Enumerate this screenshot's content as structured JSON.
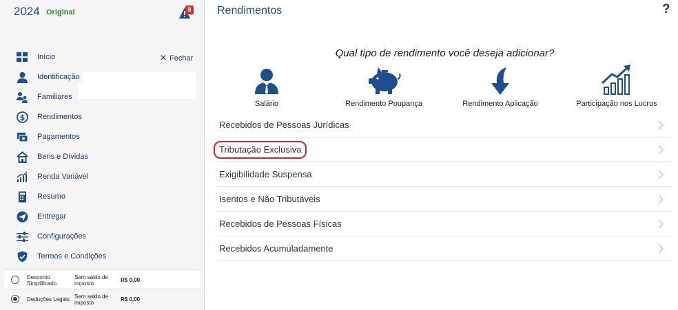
{
  "header": {
    "year": "2024",
    "version": "Original",
    "alert_count": "8"
  },
  "sidebar": {
    "close_label": "Fechar",
    "items": [
      {
        "label": "Início",
        "icon": "grid-icon"
      },
      {
        "label": "Identificação",
        "icon": "person-icon"
      },
      {
        "label": "Familiares",
        "icon": "family-icon"
      },
      {
        "label": "Rendimentos",
        "icon": "dollar-icon"
      },
      {
        "label": "Pagamentos",
        "icon": "payment-icon"
      },
      {
        "label": "Bens e Dívidas",
        "icon": "house-icon"
      },
      {
        "label": "Renda Variável",
        "icon": "chart-icon"
      },
      {
        "label": "Resumo",
        "icon": "calculator-icon"
      },
      {
        "label": "Entregar",
        "icon": "send-icon"
      },
      {
        "label": "Configurações",
        "icon": "sliders-icon"
      },
      {
        "label": "Termos e Condições",
        "icon": "shield-icon"
      }
    ],
    "summary": [
      {
        "name": "Desconto Simplificado",
        "status": "Sem saldo de imposto",
        "value": "R$ 0,00",
        "selected": false
      },
      {
        "name": "Deduções Legais",
        "status": "Sem saldo de imposto",
        "value": "R$ 0,00",
        "selected": true
      }
    ]
  },
  "main": {
    "title": "Rendimentos",
    "help": "?",
    "question": "Qual tipo de rendimento você deseja adicionar?",
    "categories": [
      {
        "label": "Salário",
        "icon": "worker-icon"
      },
      {
        "label": "Rendimento Poupança",
        "icon": "piggy-bank-icon"
      },
      {
        "label": "Rendimento Aplicação",
        "icon": "arrow-down-icon"
      },
      {
        "label": "Participação nos Lucros",
        "icon": "growth-chart-icon"
      }
    ],
    "list": [
      "Recebidos de Pessoas Jurídicas",
      "Tributação Exclusiva",
      "Exigibilidade Suspensa",
      "Isentos e Não Tributáveis",
      "Recebidos de Pessoas Físicas",
      "Recebidos Acumuladamente"
    ]
  },
  "colors": {
    "primary": "#1f4e8c",
    "accent_green": "#2e8b2e",
    "highlight_red": "#d0252b",
    "badge_red": "#d32f2f"
  }
}
